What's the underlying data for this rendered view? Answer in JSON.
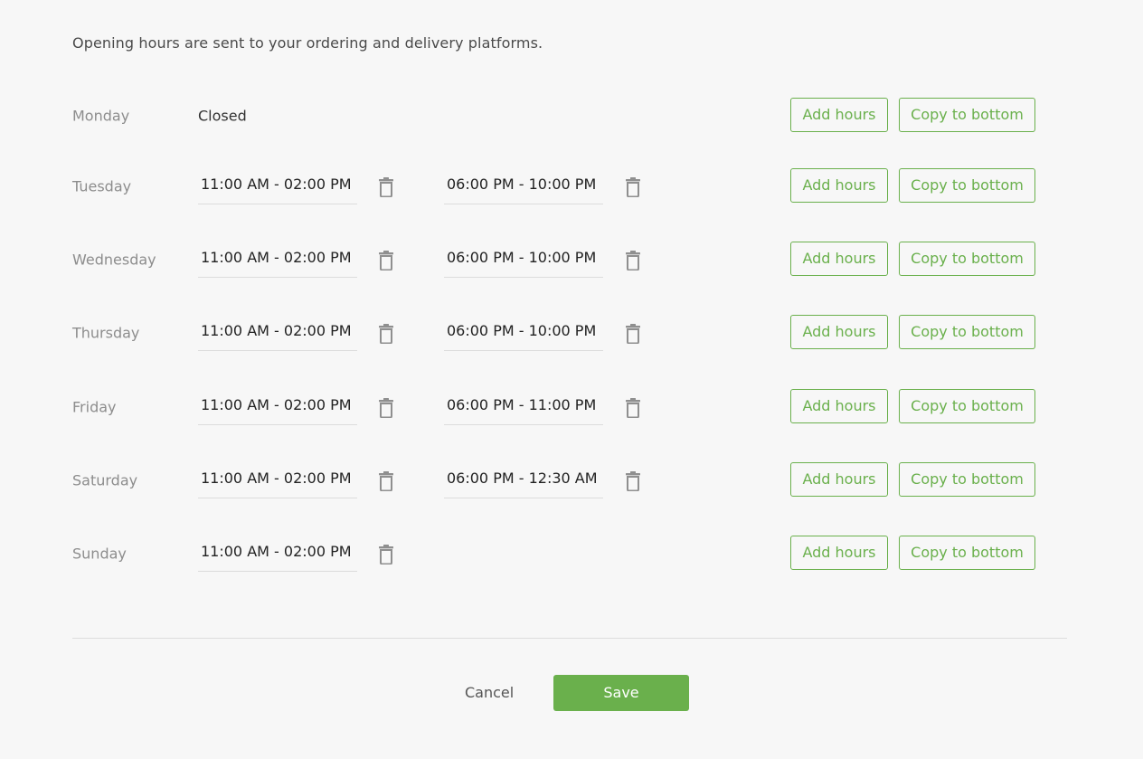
{
  "intro": "Opening hours are sent to your ordering and delivery platforms.",
  "labels": {
    "add_hours": "Add hours",
    "copy_to_bottom": "Copy to bottom",
    "closed": "Closed"
  },
  "days": [
    {
      "name": "Monday",
      "closed": true,
      "slots": []
    },
    {
      "name": "Tuesday",
      "closed": false,
      "slots": [
        {
          "start": "11:00 AM",
          "end": "02:00 PM"
        },
        {
          "start": "06:00 PM",
          "end": "10:00 PM"
        }
      ]
    },
    {
      "name": "Wednesday",
      "closed": false,
      "slots": [
        {
          "start": "11:00 AM",
          "end": "02:00 PM"
        },
        {
          "start": "06:00 PM",
          "end": "10:00 PM"
        }
      ]
    },
    {
      "name": "Thursday",
      "closed": false,
      "slots": [
        {
          "start": "11:00 AM",
          "end": "02:00 PM"
        },
        {
          "start": "06:00 PM",
          "end": "10:00 PM"
        }
      ]
    },
    {
      "name": "Friday",
      "closed": false,
      "slots": [
        {
          "start": "11:00 AM",
          "end": "02:00 PM"
        },
        {
          "start": "06:00 PM",
          "end": "11:00 PM"
        }
      ]
    },
    {
      "name": "Saturday",
      "closed": false,
      "slots": [
        {
          "start": "11:00 AM",
          "end": "02:00 PM"
        },
        {
          "start": "06:00 PM",
          "end": "12:30 AM"
        }
      ]
    },
    {
      "name": "Sunday",
      "closed": false,
      "slots": [
        {
          "start": "11:00 AM",
          "end": "02:00 PM"
        }
      ]
    }
  ],
  "actions": {
    "cancel": "Cancel",
    "save": "Save"
  },
  "colors": {
    "accent": "#6ab04c",
    "background": "#f7f7f7"
  },
  "icons": {
    "delete": "trash-icon"
  }
}
